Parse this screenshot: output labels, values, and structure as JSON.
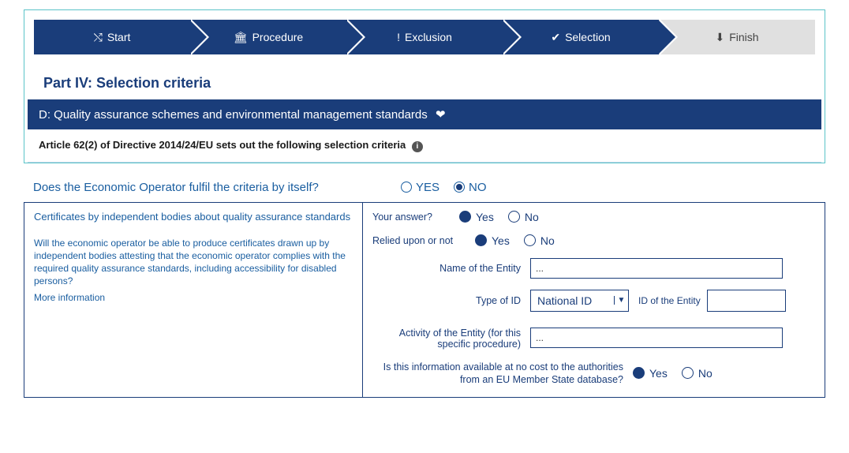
{
  "steps": {
    "start": "Start",
    "procedure": "Procedure",
    "exclusion": "Exclusion",
    "selection": "Selection",
    "finish": "Finish"
  },
  "part_title": "Part IV: Selection criteria",
  "section_bar": "D: Quality assurance schemes and environmental management standards",
  "article_text": "Article 62(2) of Directive 2014/24/EU sets out the following selection criteria",
  "fulfil_question": "Does the Economic Operator fulfil the criteria by itself?",
  "yes": "YES",
  "no": "NO",
  "left": {
    "heading": "Certificates by independent bodies about quality assurance standards",
    "body": "Will the economic operator be able to produce certificates drawn up by independent bodies attesting that the economic operator complies with the required quality assurance standards, including accessibility for disabled persons?",
    "more": "More information"
  },
  "form": {
    "your_answer": "Your answer?",
    "relied": "Relied upon or not",
    "name_entity": "Name of the Entity",
    "type_id": "Type of ID",
    "id_type_value": "National ID",
    "id_entity": "ID of the Entity",
    "activity": "Activity of the Entity (for this specific procedure)",
    "availability": "Is this information available at no cost to the authorities from an EU Member State database?",
    "yes": "Yes",
    "no": "No",
    "placeholder": "..."
  }
}
